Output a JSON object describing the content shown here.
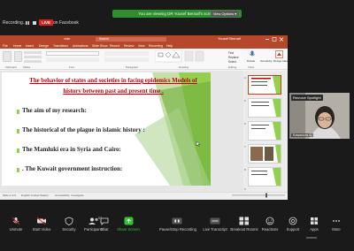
{
  "zoom_top": {
    "recording_label": "Recording...",
    "live_badge": "LIVE",
    "live_on": "on Facebook",
    "viewing_banner": "You are viewing DR Yousef Bernaif's screen",
    "view_options": "View Options ▾"
  },
  "powerpoint": {
    "file_name": "vide",
    "search_placeholder": "Search",
    "user_name": "Yousef Bernaif",
    "tabs": [
      "File",
      "Home",
      "Insert",
      "Design",
      "Transitions",
      "Animations",
      "Slide Show",
      "Record",
      "Review",
      "View",
      "Recording",
      "Help"
    ],
    "ribbon_groups": [
      "Clipboard",
      "Slides",
      "Font",
      "Paragraph",
      "Drawing",
      "Editing",
      "Voice",
      "Sensitivity",
      "Designer"
    ],
    "ribbon_buttons": [
      "New Slide",
      "Reuse Slides",
      "Find",
      "Replace",
      "Select",
      "Dictate",
      "Sensitivity",
      "Design Ideas"
    ],
    "status_left": "Slide 4 of 9",
    "status_lang": "English (United States)",
    "status_access": "Accessibility: Investigate",
    "thumbnail_numbers": [
      "4",
      "5",
      "6",
      "7",
      "8",
      "9"
    ]
  },
  "slide": {
    "title": "The behavior of states and societies in facing epidemics Models of history between past and present time .",
    "bullets": [
      "The aim of my research:",
      "The historical   of the plague in islamic history :",
      "The Mamluki era in Syria and  Cairo:",
      ". The Kuwait government  instruction:"
    ]
  },
  "participant": {
    "spotlight_label": "Remove Spotlight",
    "name": "Kawadura Al"
  },
  "toolbar": {
    "items": [
      {
        "label": "Unmute",
        "icon": "mic-off-icon"
      },
      {
        "label": "Start Video",
        "icon": "video-off-icon"
      },
      {
        "label": "Security",
        "icon": "shield-icon"
      },
      {
        "label": "Participants",
        "icon": "participants-icon",
        "count": "57"
      },
      {
        "label": "Chat",
        "icon": "chat-icon"
      },
      {
        "label": "Share Screen",
        "icon": "share-screen-icon"
      },
      {
        "label": "Pause/Stop Recording",
        "icon": "pause-recording-icon"
      },
      {
        "label": "Live Transcript",
        "icon": "cc-icon"
      },
      {
        "label": "Breakout Rooms",
        "icon": "breakout-icon"
      },
      {
        "label": "Reactions",
        "icon": "reactions-icon"
      },
      {
        "label": "Support",
        "icon": "support-icon"
      },
      {
        "label": "Apps",
        "icon": "apps-icon"
      },
      {
        "label": "More",
        "icon": "more-icon"
      }
    ]
  },
  "colors": {
    "ppt_accent": "#b7472a",
    "slide_title": "#c00000",
    "slide_green": "#92d050",
    "zoom_green": "#2d8f2d",
    "live_red": "#e02020"
  }
}
